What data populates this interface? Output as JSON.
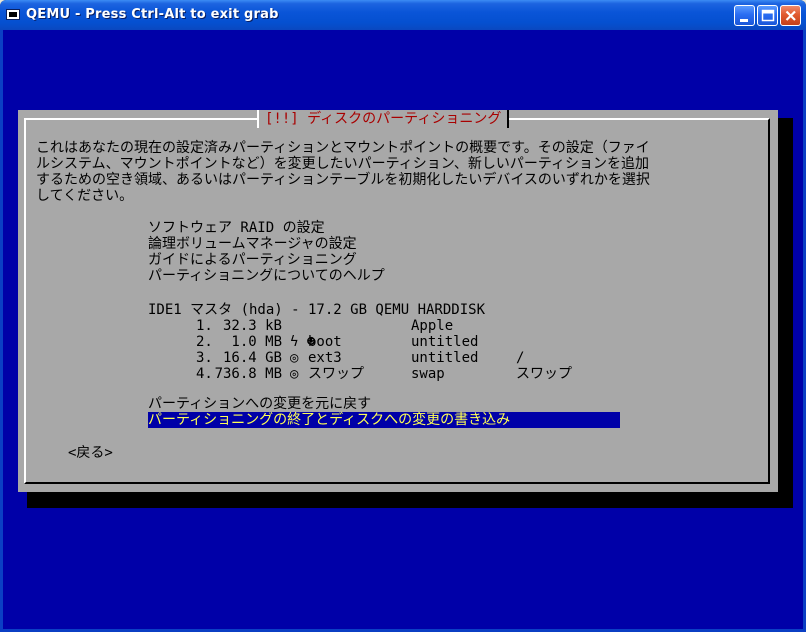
{
  "window": {
    "title": "QEMU - Press Ctrl-Alt to exit grab"
  },
  "dialog": {
    "title": "[!!] ディスクのパーティショニング",
    "description_lines": [
      "これはあなたの現在の設定済みパーティションとマウントポイントの概要です。その設定（ファイ",
      "ルシステム、マウントポイントなど）を変更したいパーティション、新しいパーティションを追加",
      "するための空き領域、あるいはパーティションテーブルを初期化したいデバイスのいずれかを選択",
      "してください。"
    ],
    "menu_items": [
      "ソフトウェア RAID の設定",
      "論理ボリュームマネージャの設定",
      "ガイドによるパーティショニング",
      "パーティショニングについてのヘルプ"
    ],
    "disk": {
      "label": "IDE1 マスタ (hda) - 17.2 GB QEMU HARDDISK",
      "partitions": [
        {
          "num": "1.",
          "size": "32.3 kB",
          "flag": "",
          "fs": "",
          "name": "Apple",
          "mount": ""
        },
        {
          "num": "2.",
          "size": "1.0 MB",
          "flag": "ϟ ☻",
          "fs": "boot",
          "name": "untitled",
          "mount": ""
        },
        {
          "num": "3.",
          "size": "16.4 GB",
          "flag": "◎",
          "fs": "ext3",
          "name": "untitled",
          "mount": "/"
        },
        {
          "num": "4.",
          "size": "736.8 MB",
          "flag": "◎",
          "fs": "スワップ",
          "name": "swap",
          "mount": "スワップ"
        }
      ]
    },
    "actions": {
      "undo": "パーティションへの変更を元に戻す",
      "finish": "パーティショニングの終了とディスクへの変更の書き込み"
    },
    "back_label": "<戻る>"
  },
  "colors": {
    "background": "#0000a8",
    "dialog": "#a8a8a8",
    "title_text": "#a80000",
    "selected_bg": "#0000a8",
    "selected_text": "#ffff54"
  }
}
